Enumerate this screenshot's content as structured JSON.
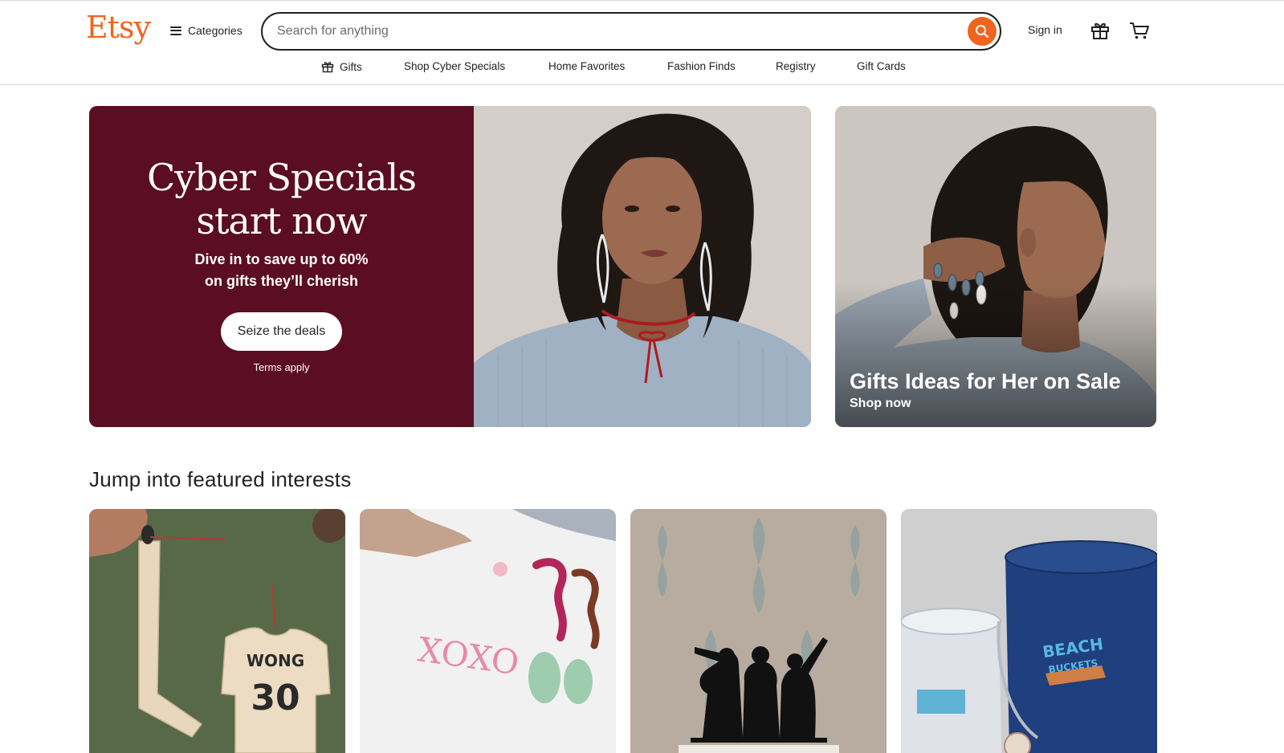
{
  "brand": {
    "logo_text": "Etsy",
    "accent_color": "#f1641e"
  },
  "header": {
    "categories_label": "Categories",
    "search": {
      "placeholder": "Search for anything",
      "value": ""
    },
    "sign_in_label": "Sign in",
    "icons": {
      "menu": "hamburger-icon",
      "search": "search-icon",
      "gift": "gift-icon",
      "cart": "cart-icon"
    }
  },
  "nav": {
    "items": [
      {
        "label": "Gifts",
        "icon": "gift-icon"
      },
      {
        "label": "Shop Cyber Specials"
      },
      {
        "label": "Home Favorites"
      },
      {
        "label": "Fashion Finds"
      },
      {
        "label": "Registry"
      },
      {
        "label": "Gift Cards"
      }
    ]
  },
  "hero": {
    "title_line1": "Cyber Specials",
    "title_line2": "start now",
    "subtitle_line1": "Dive in to save up to 60%",
    "subtitle_line2": "on gifts they’ll cherish",
    "cta_label": "Seize the deals",
    "terms_label": "Terms apply",
    "background_color": "#5b0d23"
  },
  "side_promo": {
    "title": "Gifts Ideas for Her on Sale",
    "link_label": "Shop now"
  },
  "featured": {
    "heading": "Jump into featured interests",
    "cards": [
      {
        "image": "hockey-ornaments-image"
      },
      {
        "image": "cross-stitch-image"
      },
      {
        "image": "band-silhouette-cake-topper-image"
      },
      {
        "image": "beach-buckets-image"
      }
    ]
  }
}
